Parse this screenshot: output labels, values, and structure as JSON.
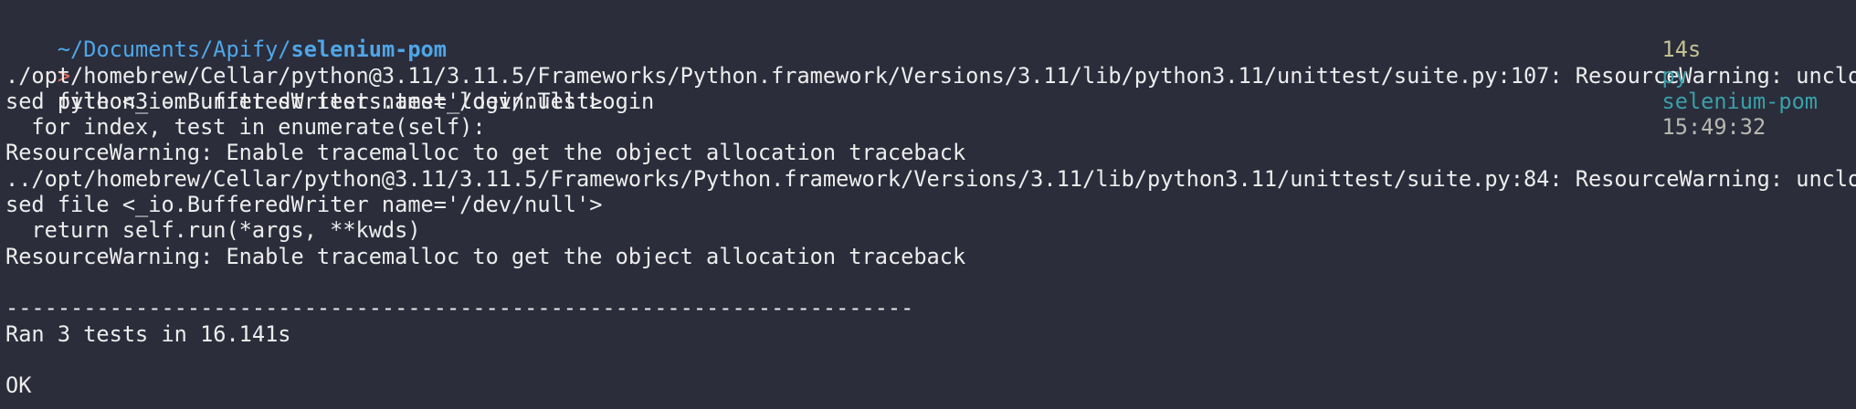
{
  "header": {
    "path_prefix": "~/Documents/Apify/",
    "path_dir": "selenium-pom",
    "duration": "14s",
    "py_label": "py",
    "env_name": "selenium-pom",
    "time": "15:49:32"
  },
  "command": {
    "prompt": ">",
    "text": "python3 -m unittest tests.test_login.TestLogin"
  },
  "output": {
    "lines": [
      "./opt/homebrew/Cellar/python@3.11/3.11.5/Frameworks/Python.framework/Versions/3.11/lib/python3.11/unittest/suite.py:107: ResourceWarning: unclo",
      "sed file <_io.BufferedWriter name='/dev/null'>",
      "  for index, test in enumerate(self):",
      "ResourceWarning: Enable tracemalloc to get the object allocation traceback",
      "../opt/homebrew/Cellar/python@3.11/3.11.5/Frameworks/Python.framework/Versions/3.11/lib/python3.11/unittest/suite.py:84: ResourceWarning: unclo",
      "sed file <_io.BufferedWriter name='/dev/null'>",
      "  return self.run(*args, **kwds)",
      "ResourceWarning: Enable tracemalloc to get the object allocation traceback",
      "",
      "----------------------------------------------------------------------",
      "Ran 3 tests in 16.141s",
      "",
      "OK"
    ]
  },
  "colors": {
    "background": "#2b2d3b",
    "path": "#4fa6e8",
    "prompt": "#e06c5f",
    "duration": "#c3c392",
    "env": "#39a0a8",
    "time": "#b8b8b0",
    "text": "#ededed"
  }
}
